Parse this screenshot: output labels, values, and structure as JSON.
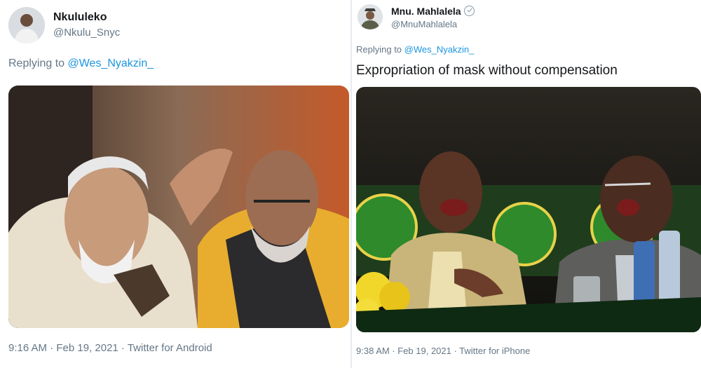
{
  "tweets": [
    {
      "display_name": "Nkululeko",
      "handle": "@Nkulu_Snyc",
      "replying_prefix": "Replying to",
      "replying_to": "@Wes_Nyakzin_",
      "text": "",
      "timestamp": "9:16 AM · Feb 19, 2021 · Twitter for Android",
      "avatar_icon": "user-avatar-icon",
      "image_description_colors": {
        "bg": "#6b4a3a",
        "accent": "#e8b030"
      }
    },
    {
      "display_name": "Mnu. Mahlalela",
      "handle": "@MnuMahlalela",
      "replying_prefix": "Replying to",
      "replying_to": "@Wes_Nyakzin_",
      "text": "Expropriation of mask without compensation",
      "timestamp": "9:38 AM · Feb 19, 2021 · Twitter for iPhone",
      "avatar_icon": "user-avatar-icon",
      "image_description_colors": {
        "bg": "#1f3d1c",
        "accent": "#3fb23f"
      }
    }
  ],
  "colors": {
    "link": "#1b95e0",
    "muted": "#657786",
    "text": "#14171a"
  }
}
